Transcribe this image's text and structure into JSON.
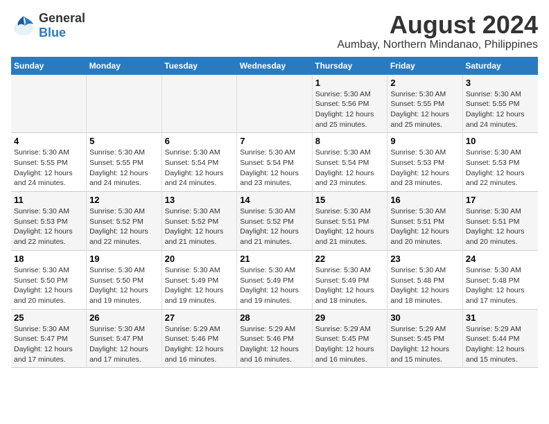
{
  "logo": {
    "line1": "General",
    "line2": "Blue"
  },
  "title": "August 2024",
  "subtitle": "Aumbay, Northern Mindanao, Philippines",
  "days_of_week": [
    "Sunday",
    "Monday",
    "Tuesday",
    "Wednesday",
    "Thursday",
    "Friday",
    "Saturday"
  ],
  "weeks": [
    [
      {
        "day": "",
        "info": ""
      },
      {
        "day": "",
        "info": ""
      },
      {
        "day": "",
        "info": ""
      },
      {
        "day": "",
        "info": ""
      },
      {
        "day": "1",
        "info": "Sunrise: 5:30 AM\nSunset: 5:56 PM\nDaylight: 12 hours\nand 25 minutes."
      },
      {
        "day": "2",
        "info": "Sunrise: 5:30 AM\nSunset: 5:55 PM\nDaylight: 12 hours\nand 25 minutes."
      },
      {
        "day": "3",
        "info": "Sunrise: 5:30 AM\nSunset: 5:55 PM\nDaylight: 12 hours\nand 24 minutes."
      }
    ],
    [
      {
        "day": "4",
        "info": "Sunrise: 5:30 AM\nSunset: 5:55 PM\nDaylight: 12 hours\nand 24 minutes."
      },
      {
        "day": "5",
        "info": "Sunrise: 5:30 AM\nSunset: 5:55 PM\nDaylight: 12 hours\nand 24 minutes."
      },
      {
        "day": "6",
        "info": "Sunrise: 5:30 AM\nSunset: 5:54 PM\nDaylight: 12 hours\nand 24 minutes."
      },
      {
        "day": "7",
        "info": "Sunrise: 5:30 AM\nSunset: 5:54 PM\nDaylight: 12 hours\nand 23 minutes."
      },
      {
        "day": "8",
        "info": "Sunrise: 5:30 AM\nSunset: 5:54 PM\nDaylight: 12 hours\nand 23 minutes."
      },
      {
        "day": "9",
        "info": "Sunrise: 5:30 AM\nSunset: 5:53 PM\nDaylight: 12 hours\nand 23 minutes."
      },
      {
        "day": "10",
        "info": "Sunrise: 5:30 AM\nSunset: 5:53 PM\nDaylight: 12 hours\nand 22 minutes."
      }
    ],
    [
      {
        "day": "11",
        "info": "Sunrise: 5:30 AM\nSunset: 5:53 PM\nDaylight: 12 hours\nand 22 minutes."
      },
      {
        "day": "12",
        "info": "Sunrise: 5:30 AM\nSunset: 5:52 PM\nDaylight: 12 hours\nand 22 minutes."
      },
      {
        "day": "13",
        "info": "Sunrise: 5:30 AM\nSunset: 5:52 PM\nDaylight: 12 hours\nand 21 minutes."
      },
      {
        "day": "14",
        "info": "Sunrise: 5:30 AM\nSunset: 5:52 PM\nDaylight: 12 hours\nand 21 minutes."
      },
      {
        "day": "15",
        "info": "Sunrise: 5:30 AM\nSunset: 5:51 PM\nDaylight: 12 hours\nand 21 minutes."
      },
      {
        "day": "16",
        "info": "Sunrise: 5:30 AM\nSunset: 5:51 PM\nDaylight: 12 hours\nand 20 minutes."
      },
      {
        "day": "17",
        "info": "Sunrise: 5:30 AM\nSunset: 5:51 PM\nDaylight: 12 hours\nand 20 minutes."
      }
    ],
    [
      {
        "day": "18",
        "info": "Sunrise: 5:30 AM\nSunset: 5:50 PM\nDaylight: 12 hours\nand 20 minutes."
      },
      {
        "day": "19",
        "info": "Sunrise: 5:30 AM\nSunset: 5:50 PM\nDaylight: 12 hours\nand 19 minutes."
      },
      {
        "day": "20",
        "info": "Sunrise: 5:30 AM\nSunset: 5:49 PM\nDaylight: 12 hours\nand 19 minutes."
      },
      {
        "day": "21",
        "info": "Sunrise: 5:30 AM\nSunset: 5:49 PM\nDaylight: 12 hours\nand 19 minutes."
      },
      {
        "day": "22",
        "info": "Sunrise: 5:30 AM\nSunset: 5:49 PM\nDaylight: 12 hours\nand 18 minutes."
      },
      {
        "day": "23",
        "info": "Sunrise: 5:30 AM\nSunset: 5:48 PM\nDaylight: 12 hours\nand 18 minutes."
      },
      {
        "day": "24",
        "info": "Sunrise: 5:30 AM\nSunset: 5:48 PM\nDaylight: 12 hours\nand 17 minutes."
      }
    ],
    [
      {
        "day": "25",
        "info": "Sunrise: 5:30 AM\nSunset: 5:47 PM\nDaylight: 12 hours\nand 17 minutes."
      },
      {
        "day": "26",
        "info": "Sunrise: 5:30 AM\nSunset: 5:47 PM\nDaylight: 12 hours\nand 17 minutes."
      },
      {
        "day": "27",
        "info": "Sunrise: 5:29 AM\nSunset: 5:46 PM\nDaylight: 12 hours\nand 16 minutes."
      },
      {
        "day": "28",
        "info": "Sunrise: 5:29 AM\nSunset: 5:46 PM\nDaylight: 12 hours\nand 16 minutes."
      },
      {
        "day": "29",
        "info": "Sunrise: 5:29 AM\nSunset: 5:45 PM\nDaylight: 12 hours\nand 16 minutes."
      },
      {
        "day": "30",
        "info": "Sunrise: 5:29 AM\nSunset: 5:45 PM\nDaylight: 12 hours\nand 15 minutes."
      },
      {
        "day": "31",
        "info": "Sunrise: 5:29 AM\nSunset: 5:44 PM\nDaylight: 12 hours\nand 15 minutes."
      }
    ]
  ]
}
